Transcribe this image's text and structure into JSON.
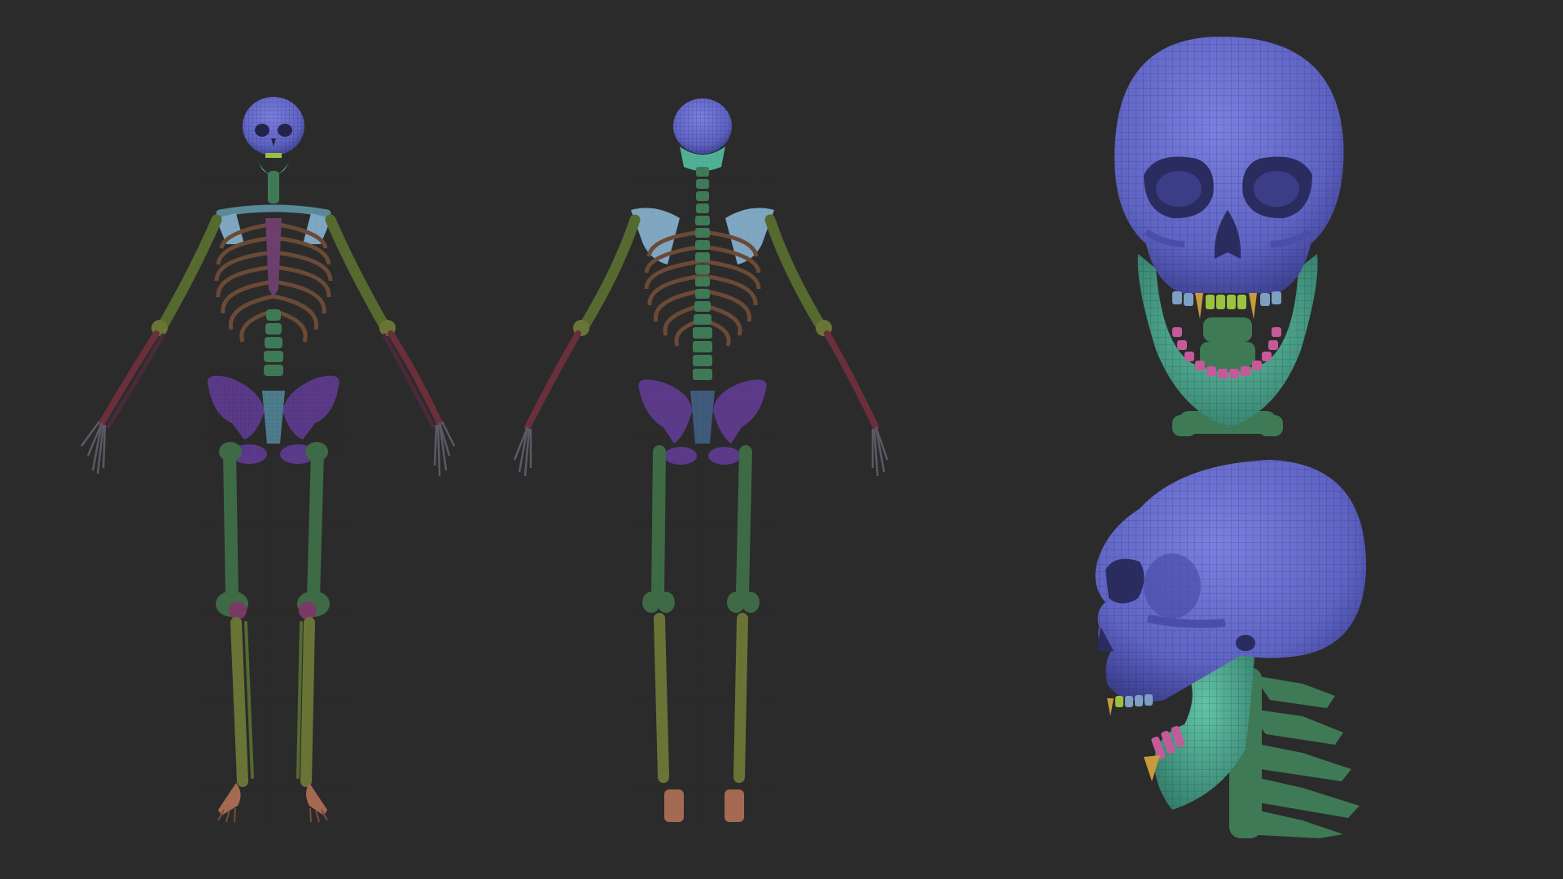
{
  "scene": {
    "background": "#2b2b2b",
    "views": [
      "skeleton-front-view",
      "skeleton-back-view",
      "skull-front-closeup",
      "skull-side-closeup"
    ]
  },
  "colors": {
    "skull": "#6166c8",
    "skull_shadow": "#3e418e",
    "jaw": "#4fb095",
    "spine": "#3f7a57",
    "ribs": "#6b4a36",
    "sternum": "#6c3f6c",
    "pelvis": "#5b3a8a",
    "scapula": "#7fa7c2",
    "femur": "#3e6b45",
    "tibia": "#6a7436",
    "arm_upper": "#566a30",
    "forearm": "#6a2f3a",
    "hand": "#5a5a66",
    "patella": "#7a3a66",
    "feet": "#a56a52",
    "teeth_upper": "#9ac241",
    "teeth_fang": "#c79a3e",
    "teeth_lower": "#c45a9a",
    "teeth_molar": "#7d9fc2"
  },
  "icons": [
    "skull-icon",
    "skeleton-icon"
  ]
}
